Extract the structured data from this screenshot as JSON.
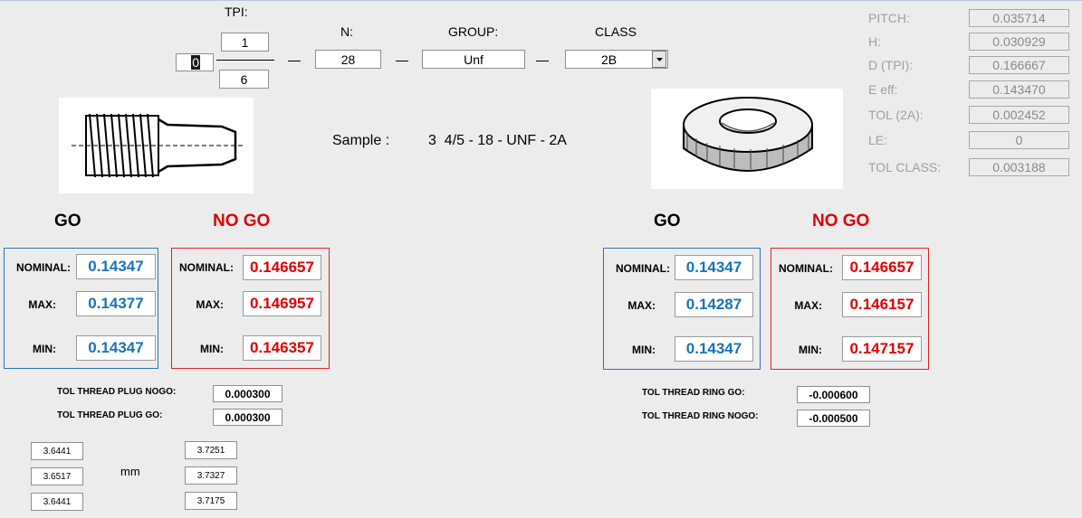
{
  "tpi": {
    "label": "TPI:",
    "whole": "0",
    "numerator": "1",
    "denominator": "6"
  },
  "n": {
    "label": "N:",
    "value": "28"
  },
  "group": {
    "label": "GROUP:",
    "value": "Unf"
  },
  "class": {
    "label": "CLASS",
    "value": "2B"
  },
  "sample": {
    "label": "Sample :",
    "value": "3  4/5 - 18 - UNF - 2A"
  },
  "params": [
    {
      "label": "PITCH:",
      "value": "0.035714"
    },
    {
      "label": "H:",
      "value": "0.030929"
    },
    {
      "label": "D (TPI):",
      "value": "0.166667"
    },
    {
      "label": "E eff:",
      "value": "0.143470"
    },
    {
      "label": "TOL (2A):",
      "value": "0.002452"
    },
    {
      "label": "LE:",
      "value": "0"
    },
    {
      "label": "TOL CLASS:",
      "value": "0.003188"
    }
  ],
  "plug": {
    "go_title": "GO",
    "nogo_title": "NO GO",
    "row_labels": [
      "NOMINAL:",
      "MAX:",
      "MIN:"
    ],
    "go": [
      "0.14347",
      "0.14377",
      "0.14347"
    ],
    "nogo": [
      "0.146657",
      "0.146957",
      "0.146357"
    ],
    "tol_nogo_label": "TOL THREAD PLUG NOGO:",
    "tol_nogo_value": "0.000300",
    "tol_go_label": "TOL THREAD PLUG GO:",
    "tol_go_value": "0.000300"
  },
  "ring": {
    "go_title": "GO",
    "nogo_title": "NO GO",
    "row_labels": [
      "NOMINAL:",
      "MAX:",
      "MIN:"
    ],
    "go": [
      "0.14347",
      "0.14287",
      "0.14347"
    ],
    "nogo": [
      "0.146657",
      "0.146157",
      "0.147157"
    ],
    "tol_go_label": "TOL THREAD RING GO:",
    "tol_go_value": "-0.000600",
    "tol_nogo_label": "TOL THREAD RING NOGO:",
    "tol_nogo_value": "-0.000500"
  },
  "mm": {
    "unit": "mm",
    "left": [
      "3.6441",
      "3.6517",
      "3.6441"
    ],
    "right": [
      "3.7251",
      "3.7327",
      "3.7175"
    ]
  },
  "icons": {
    "plug": "thread-plug-gauge-image",
    "ring": "thread-ring-gauge-image",
    "dropdown": "chevron-down-icon"
  }
}
